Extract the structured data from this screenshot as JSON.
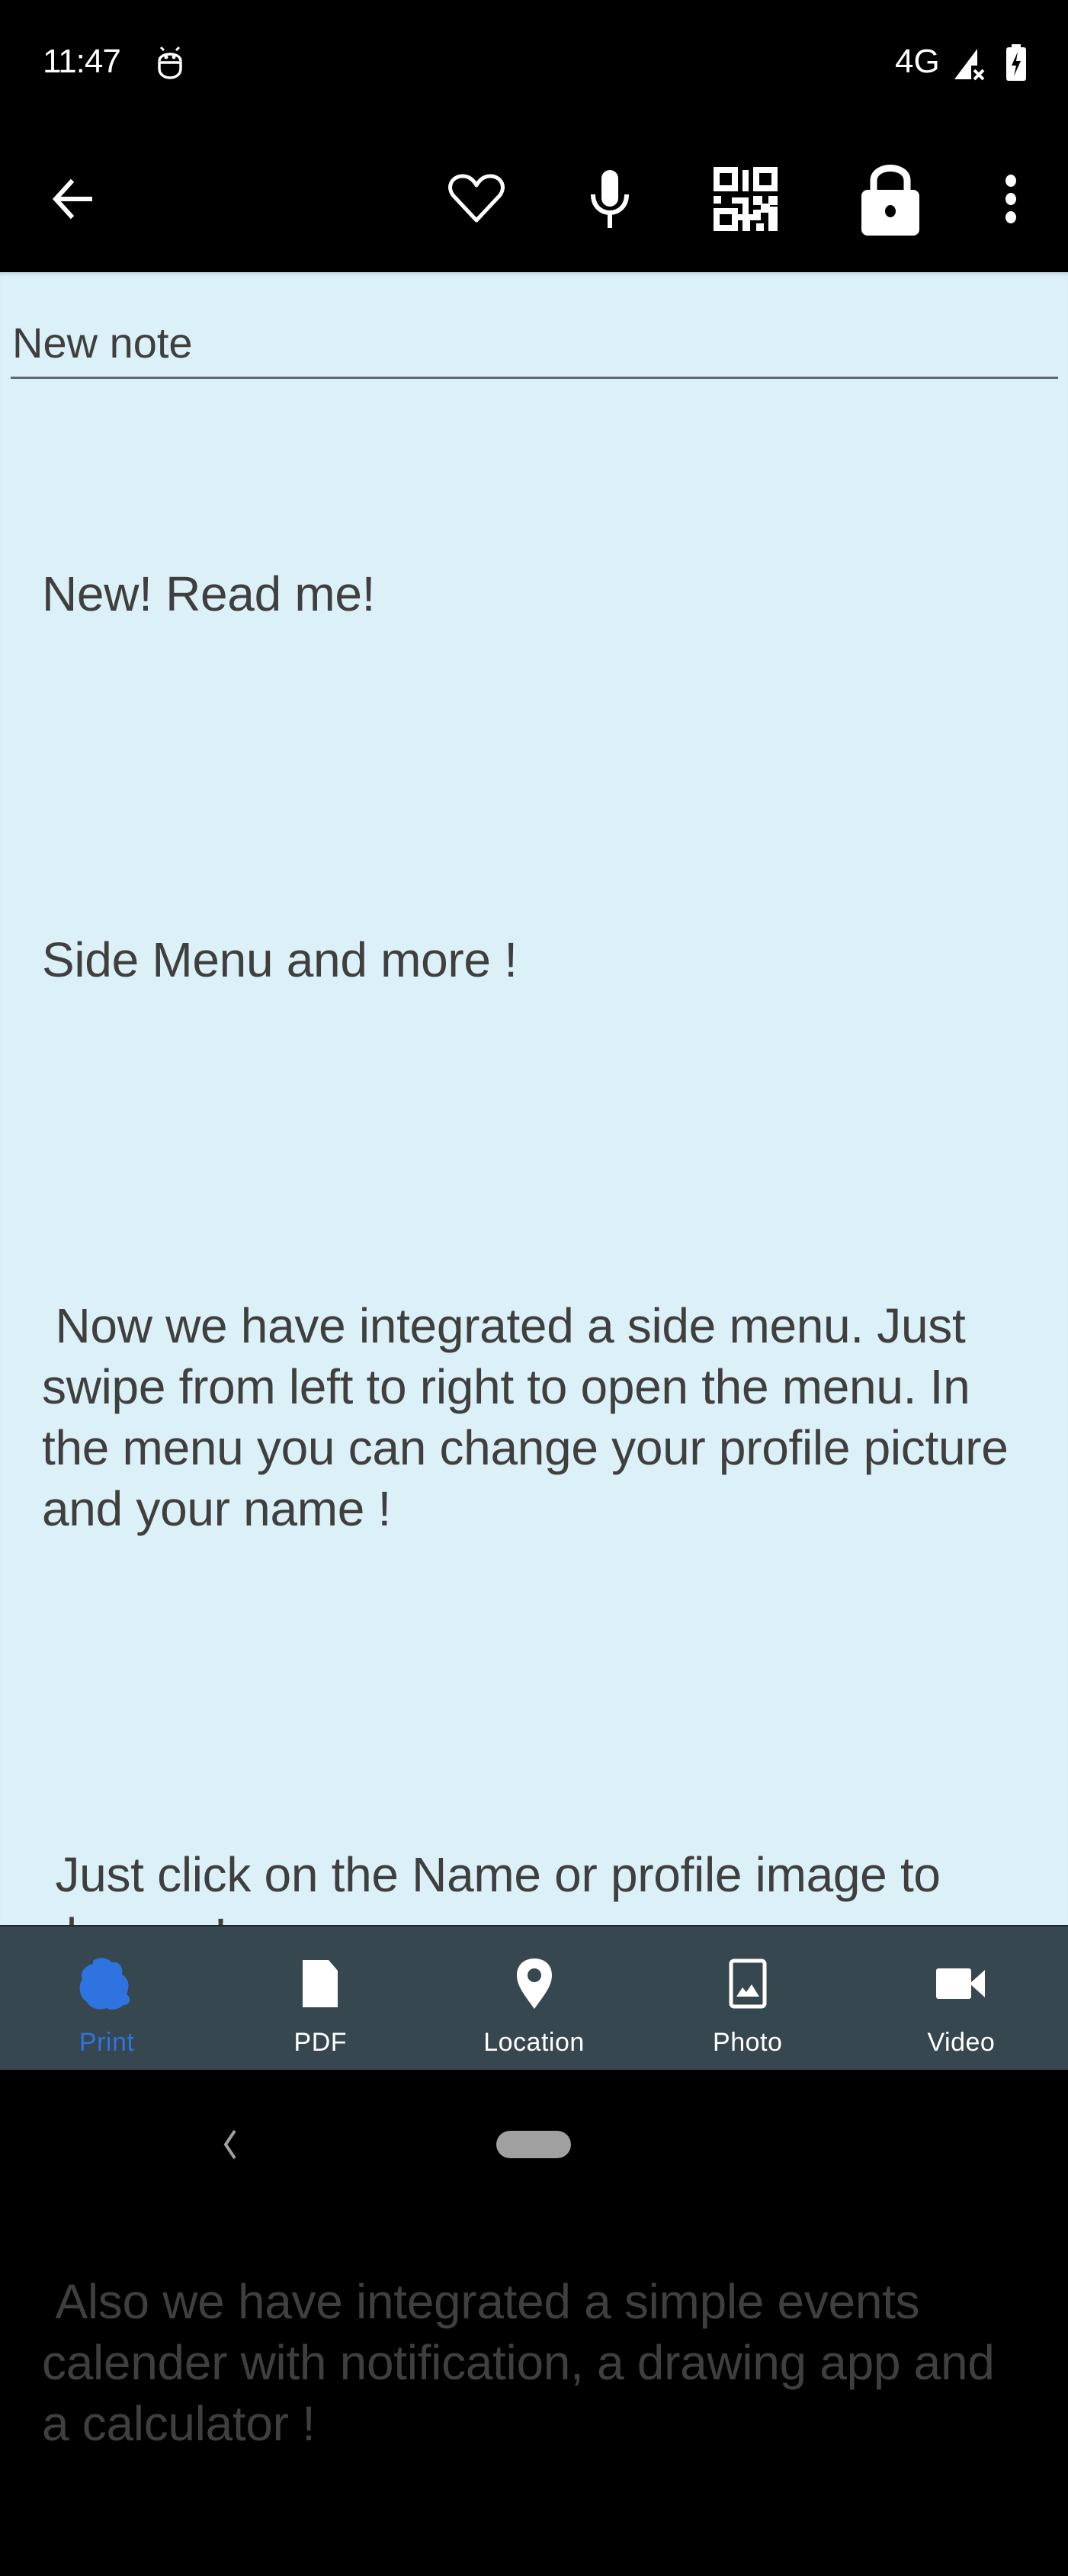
{
  "status_bar": {
    "time": "11:47",
    "network": "4G",
    "icons": [
      "app-notification-icon",
      "signal-icon",
      "battery-charging-icon"
    ]
  },
  "toolbar": {
    "icons": [
      "back-arrow-icon",
      "heart-icon",
      "microphone-icon",
      "qr-code-icon",
      "lock-icon",
      "more-vert-icon"
    ]
  },
  "note": {
    "title_value": "New note",
    "paragraphs": [
      "New! Read me!",
      "Side Menu and more !",
      " Now we have integrated a side menu. Just swipe from left to right to open the menu. In the menu you can change your profile picture and your name !",
      " Just click on the Name or profile image to change !",
      " Also we have integrated a simple events calender with notification, a drawing app and a calculator !"
    ]
  },
  "bottom_nav": {
    "active_color": "#2e73e0",
    "background": "#37474f",
    "items": [
      {
        "label": "Print",
        "icon": "print-blob-icon",
        "active": true
      },
      {
        "label": "PDF",
        "icon": "document-icon",
        "active": false
      },
      {
        "label": "Location",
        "icon": "location-pin-icon",
        "active": false
      },
      {
        "label": "Photo",
        "icon": "image-icon",
        "active": false
      },
      {
        "label": "Video",
        "icon": "videocam-icon",
        "active": false
      }
    ]
  },
  "colors": {
    "content_background": "#dcf0f7",
    "text": "#3f3f3f",
    "toolbar": "#000000"
  }
}
